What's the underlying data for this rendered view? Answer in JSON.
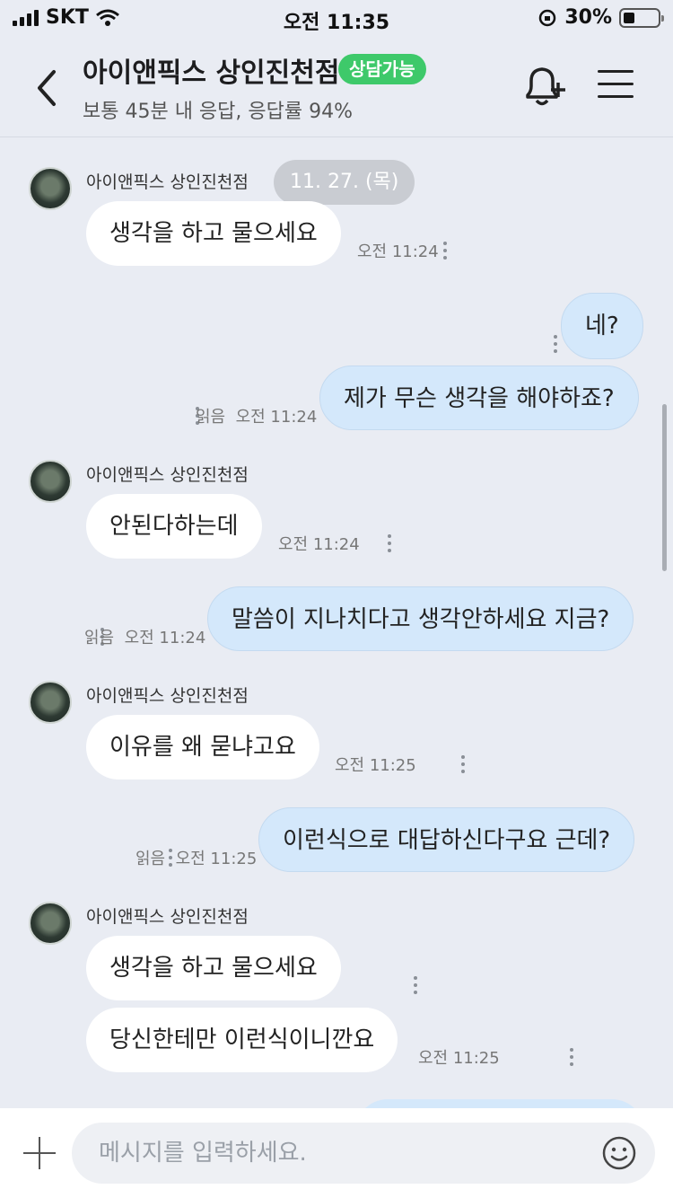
{
  "status_bar": {
    "carrier": "SKT",
    "time": "오전 11:35",
    "battery": "30%"
  },
  "header": {
    "title": "아이앤픽스 상인진천점",
    "badge": "상담가능",
    "subtitle": "보통 45분 내 응답, 응답률 94%"
  },
  "chat": {
    "date_pill": "11. 27. (목)",
    "messages": [
      {
        "sender": "아이앤픽스 상인진천점",
        "text": "생각을 하고 물으세요",
        "time": "오전 11:24"
      },
      {
        "text": "네?"
      },
      {
        "text": "제가 무슨 생각을 해야하죠?",
        "read": "읽음",
        "time": "오전 11:24"
      },
      {
        "sender": "아이앤픽스 상인진천점",
        "text": "안된다하는데",
        "time": "오전 11:24"
      },
      {
        "text": "말씀이 지나치다고 생각안하세요 지금?",
        "read": "읽음",
        "time": "오전 11:24"
      },
      {
        "sender": "아이앤픽스 상인진천점",
        "text": "이유를 왜 묻냐고요",
        "time": "오전 11:25"
      },
      {
        "text": "이런식으로 대답하신다구요 근데?",
        "read": "읽음",
        "time": "오전 11:25"
      },
      {
        "sender": "아이앤픽스 상인진천점",
        "text": "생각을 하고 물으세요"
      },
      {
        "text": "당신한테만 이런식이니깐요",
        "time": "오전 11:25"
      }
    ]
  },
  "composer": {
    "placeholder": "메시지를 입력하세요."
  },
  "colors": {
    "background": "#e9ecf3",
    "incoming_bubble": "#ffffff",
    "outgoing_bubble": "#d4e8fb",
    "badge": "#3ec96a"
  }
}
